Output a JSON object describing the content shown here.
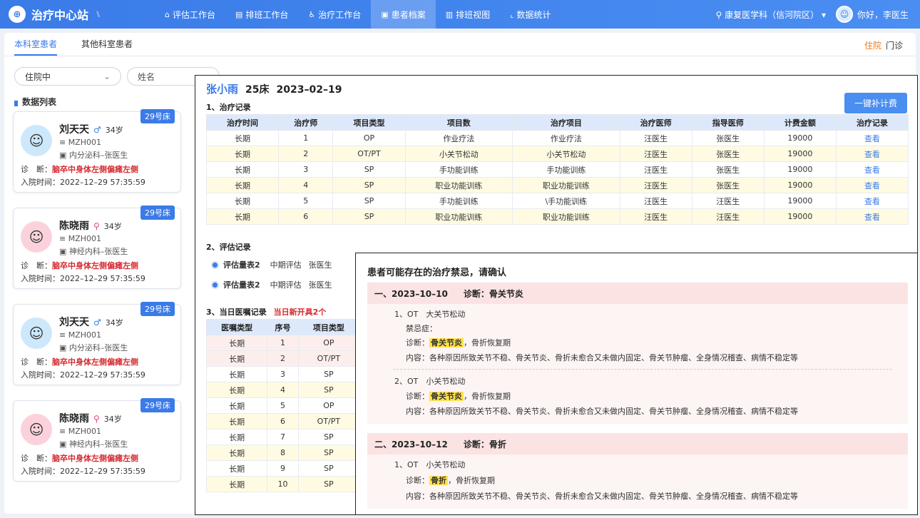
{
  "app": {
    "title": "治疗中心站",
    "mark": "⑊"
  },
  "nav": [
    {
      "icon": "⌂",
      "label": "评估工作台",
      "active": false
    },
    {
      "icon": "▤",
      "label": "排班工作台",
      "active": false
    },
    {
      "icon": "♿",
      "label": "治疗工作台",
      "active": false
    },
    {
      "icon": "▣",
      "label": "患者档案",
      "active": true
    },
    {
      "icon": "▥",
      "label": "排班视图",
      "active": false
    },
    {
      "icon": "⌞",
      "label": "数据统计",
      "active": false
    }
  ],
  "topright": {
    "hospital": "康复医学科（信河院区）",
    "greeting": "你好，李医生"
  },
  "subtabs": [
    {
      "label": "本科室患者",
      "active": true
    },
    {
      "label": "其他科室患者",
      "active": false
    }
  ],
  "mode": {
    "active": "住院",
    "other": "门诊"
  },
  "filters": {
    "status": "住院中",
    "name_placeholder": "姓名"
  },
  "list_title": "数据列表",
  "patients": [
    {
      "name": "刘天天",
      "sex": "♂",
      "sex_type": "m",
      "age": "34岁",
      "bed": "29号床",
      "id": "MZH001",
      "dept": "内分泌科–张医生",
      "dx_label": "诊　断：",
      "dx": "脑卒中身体左侧偏瘫左侧",
      "adm_label": "入院时间：",
      "adm": "2022–12–29  57:35:59"
    },
    {
      "name": "陈晓雨",
      "sex": "⚲",
      "sex_type": "f",
      "age": "34岁",
      "bed": "29号床",
      "id": "MZH001",
      "dept": "神经内科–张医生",
      "dx_label": "诊　断：",
      "dx": "脑卒中身体左侧偏瘫左侧",
      "adm_label": "入院时间：",
      "adm": "2022–12–29  57:35:59"
    },
    {
      "name": "刘天天",
      "sex": "♂",
      "sex_type": "m",
      "age": "34岁",
      "bed": "29号床",
      "id": "MZH001",
      "dept": "内分泌科–张医生",
      "dx_label": "诊　断：",
      "dx": "脑卒中身体左侧偏瘫左侧",
      "adm_label": "入院时间：",
      "adm": "2022–12–29  57:35:59"
    },
    {
      "name": "陈晓雨",
      "sex": "⚲",
      "sex_type": "f",
      "age": "34岁",
      "bed": "29号床",
      "id": "MZH001",
      "dept": "神经内科–张医生",
      "dx_label": "诊　断：",
      "dx": "脑卒中身体左侧偏瘫左侧",
      "adm_label": "入院时间：",
      "adm": "2022–12–29  57:35:59"
    }
  ],
  "detail": {
    "patient_name": "张小雨",
    "bed": "25床",
    "date": "2023–02–19",
    "fee_button": "一键补计费",
    "sec1": "1、治疗记录",
    "treat_headers": [
      "治疗时间",
      "治疗师",
      "项目类型",
      "项目数",
      "治疗项目",
      "治疗医师",
      "指导医师",
      "计费金额",
      "治疗记录"
    ],
    "treat_rows": [
      [
        "长期",
        "1",
        "OP",
        "作业疗法",
        "作业疗法",
        "汪医生",
        "张医生",
        "19000",
        "查看"
      ],
      [
        "长期",
        "2",
        "OT/PT",
        "小关节松动",
        "小关节松动",
        "汪医生",
        "张医生",
        "19000",
        "查看"
      ],
      [
        "长期",
        "3",
        "SP",
        "手功能训练",
        "手功能训练",
        "汪医生",
        "张医生",
        "19000",
        "查看"
      ],
      [
        "长期",
        "4",
        "SP",
        "职业功能训练",
        "职业功能训练",
        "汪医生",
        "张医生",
        "19000",
        "查看"
      ],
      [
        "长期",
        "5",
        "SP",
        "手功能训练",
        "\\手功能训练",
        "汪医生",
        "汪医生",
        "19000",
        "查看"
      ],
      [
        "长期",
        "6",
        "SP",
        "职业功能训练",
        "职业功能训练",
        "汪医生",
        "汪医生",
        "19000",
        "查看"
      ]
    ],
    "sec2": "2、评估记录",
    "eval_rows": [
      {
        "name": "评估量表2",
        "stage": "中期评估",
        "doctor": "张医生"
      },
      {
        "name": "评估量表2",
        "stage": "中期评估",
        "doctor": "张医生"
      }
    ],
    "sec3": "3、当日医嘱记录",
    "sec3_note": "当日新开具2个",
    "order_headers": [
      "医嘱类型",
      "序号",
      "项目类型"
    ],
    "order_rows": [
      [
        "长期",
        "1",
        "OP"
      ],
      [
        "长期",
        "2",
        "OT/PT"
      ],
      [
        "长期",
        "3",
        "SP"
      ],
      [
        "长期",
        "4",
        "SP"
      ],
      [
        "长期",
        "5",
        "OP"
      ],
      [
        "长期",
        "6",
        "OT/PT"
      ],
      [
        "长期",
        "7",
        "SP"
      ],
      [
        "长期",
        "8",
        "SP"
      ],
      [
        "长期",
        "9",
        "SP"
      ],
      [
        "长期",
        "10",
        "SP"
      ]
    ]
  },
  "contra": {
    "title": "患者可能存在的治疗禁忌，请确认",
    "groups": [
      {
        "title": "一、2023–10–10",
        "dx": "诊断：骨关节炎"
      },
      {
        "title": "二、2023–10–12",
        "dx": "诊断：骨折"
      }
    ],
    "items": {
      "a_title": "1、OT　大关节松动",
      "a_contra": "禁忌症：",
      "dx_prefix": "诊断：",
      "hl_oa": "骨关节炎",
      "hl_fx": "骨折",
      "dx_rest": "，骨折恢复期",
      "content": "内容：各种原因所致关节不稳、骨关节炎、骨折未愈合又未做内固定、骨关节肿瘤、全身情况稽查、病情不稳定等",
      "b_title": "2、OT　小关节松动",
      "c_title": "1、OT　小关节松动"
    }
  }
}
